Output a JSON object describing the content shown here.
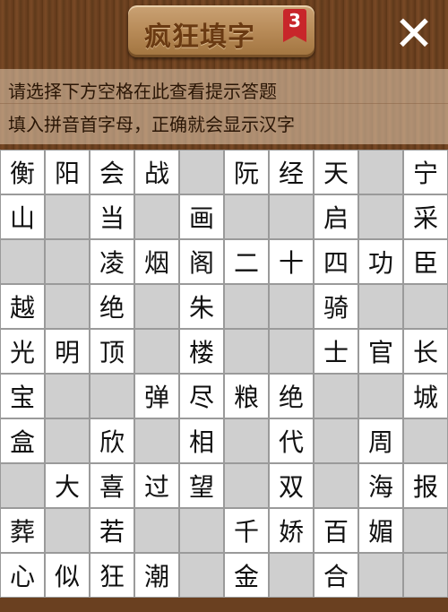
{
  "header": {
    "title": "疯狂填字",
    "level": "3",
    "close_label": "✕"
  },
  "hints": {
    "line1": "请选择下方空格在此查看提示答题",
    "line2": "填入拼音首字母，正确就会显示汉字"
  },
  "grid": {
    "rows": [
      [
        "衡",
        "阳",
        "会",
        "战",
        "",
        "阮",
        "经",
        "天",
        "",
        "宁"
      ],
      [
        "山",
        "",
        "当",
        "",
        "画",
        "",
        "",
        "启",
        "",
        "采"
      ],
      [
        "",
        "",
        "凌",
        "烟",
        "阁",
        "二",
        "十",
        "四",
        "功",
        "臣"
      ],
      [
        "越",
        "",
        "绝",
        "",
        "朱",
        "",
        "",
        "骑",
        "",
        ""
      ],
      [
        "光",
        "明",
        "顶",
        "",
        "楼",
        "",
        "",
        "士",
        "官",
        "长"
      ],
      [
        "宝",
        "",
        "",
        "弹",
        "尽",
        "粮",
        "绝",
        "",
        "",
        "城"
      ],
      [
        "盒",
        "",
        "欣",
        "",
        "相",
        "",
        "代",
        "",
        "周",
        ""
      ],
      [
        "",
        "大",
        "喜",
        "过",
        "望",
        "",
        "双",
        "",
        "海",
        "报"
      ],
      [
        "葬",
        "",
        "若",
        "",
        "",
        "千",
        "娇",
        "百",
        "媚",
        ""
      ],
      [
        "心",
        "似",
        "狂",
        "潮",
        "",
        "金",
        "",
        "合",
        "",
        ""
      ]
    ]
  }
}
